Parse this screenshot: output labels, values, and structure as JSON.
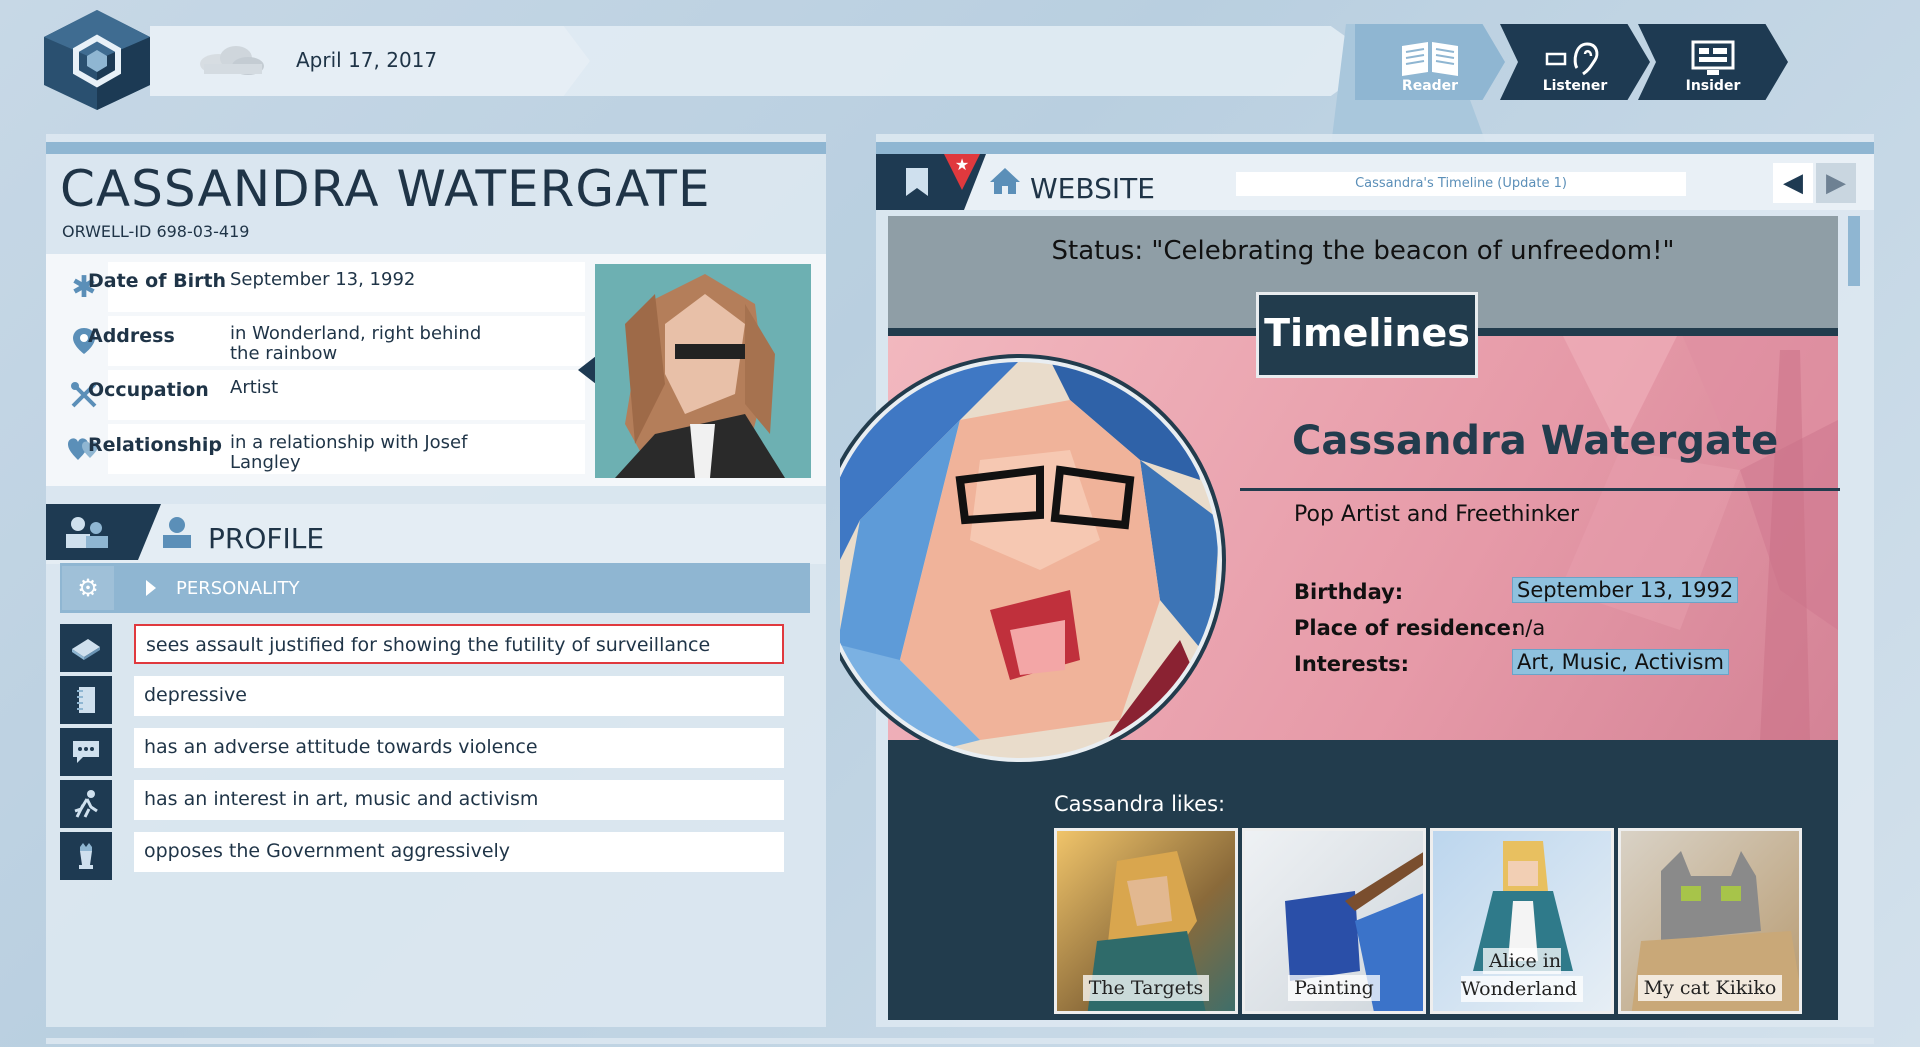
{
  "header": {
    "date": "April 17, 2017",
    "weather_icon": "cloud-icon",
    "modes": [
      {
        "label": "Reader",
        "icon": "book-icon"
      },
      {
        "label": "Listener",
        "icon": "ear-icon"
      },
      {
        "label": "Insider",
        "icon": "monitor-icon"
      }
    ]
  },
  "person": {
    "name": "CASSANDRA WATERGATE",
    "orwell_id": "ORWELL-ID  698-03-419",
    "info": [
      {
        "label": "Date of Birth",
        "value": "September 13, 1992",
        "icon": "asterisk-icon"
      },
      {
        "label": "Address",
        "value": "in Wonderland, right behind the rainbow",
        "icon": "location-pin-icon"
      },
      {
        "label": "Occupation",
        "value": "Artist",
        "icon": "tools-icon"
      },
      {
        "label": "Relationship",
        "value": "in a relationship with Josef Langley",
        "icon": "hearts-icon"
      }
    ]
  },
  "profile": {
    "title": "PROFILE",
    "section": "PERSONALITY",
    "traits": [
      {
        "text": "sees assault justified for showing the futility of surveillance",
        "icon": "book-icon",
        "selected": true
      },
      {
        "text": "depressive",
        "icon": "notebook-icon",
        "selected": false
      },
      {
        "text": "has an adverse attitude towards violence",
        "icon": "speech-bubble-icon",
        "selected": false
      },
      {
        "text": "has an interest in art, music and activism",
        "icon": "runner-icon",
        "selected": false
      },
      {
        "text": "opposes the Government aggressively",
        "icon": "chess-icon",
        "selected": false
      }
    ]
  },
  "website": {
    "title": "WEBSITE",
    "url": "Cassandra's Timeline (Update 1)",
    "status": "Status: \"Celebrating the beacon of unfreedom!\"",
    "site_name": "Timelines",
    "profile_name": "Cassandra Watergate",
    "tagline": "Pop Artist and Freethinker",
    "fields": [
      {
        "label": "Birthday:",
        "value": "September 13, 1992",
        "highlighted": true
      },
      {
        "label": "Place of residence:",
        "value": "n/a",
        "highlighted": false
      },
      {
        "label": "Interests:",
        "value": "Art, Music, Activism",
        "highlighted": true
      }
    ],
    "likes_label": "Cassandra likes:",
    "likes": [
      "The Targets",
      "Painting",
      "Alice in Wonderland",
      "My cat Kikiko"
    ]
  },
  "colors": {
    "dark": "#1e3a52",
    "accent": "#8fb6d2",
    "highlight": "#8fc1de",
    "selection_border": "#e0393e"
  }
}
